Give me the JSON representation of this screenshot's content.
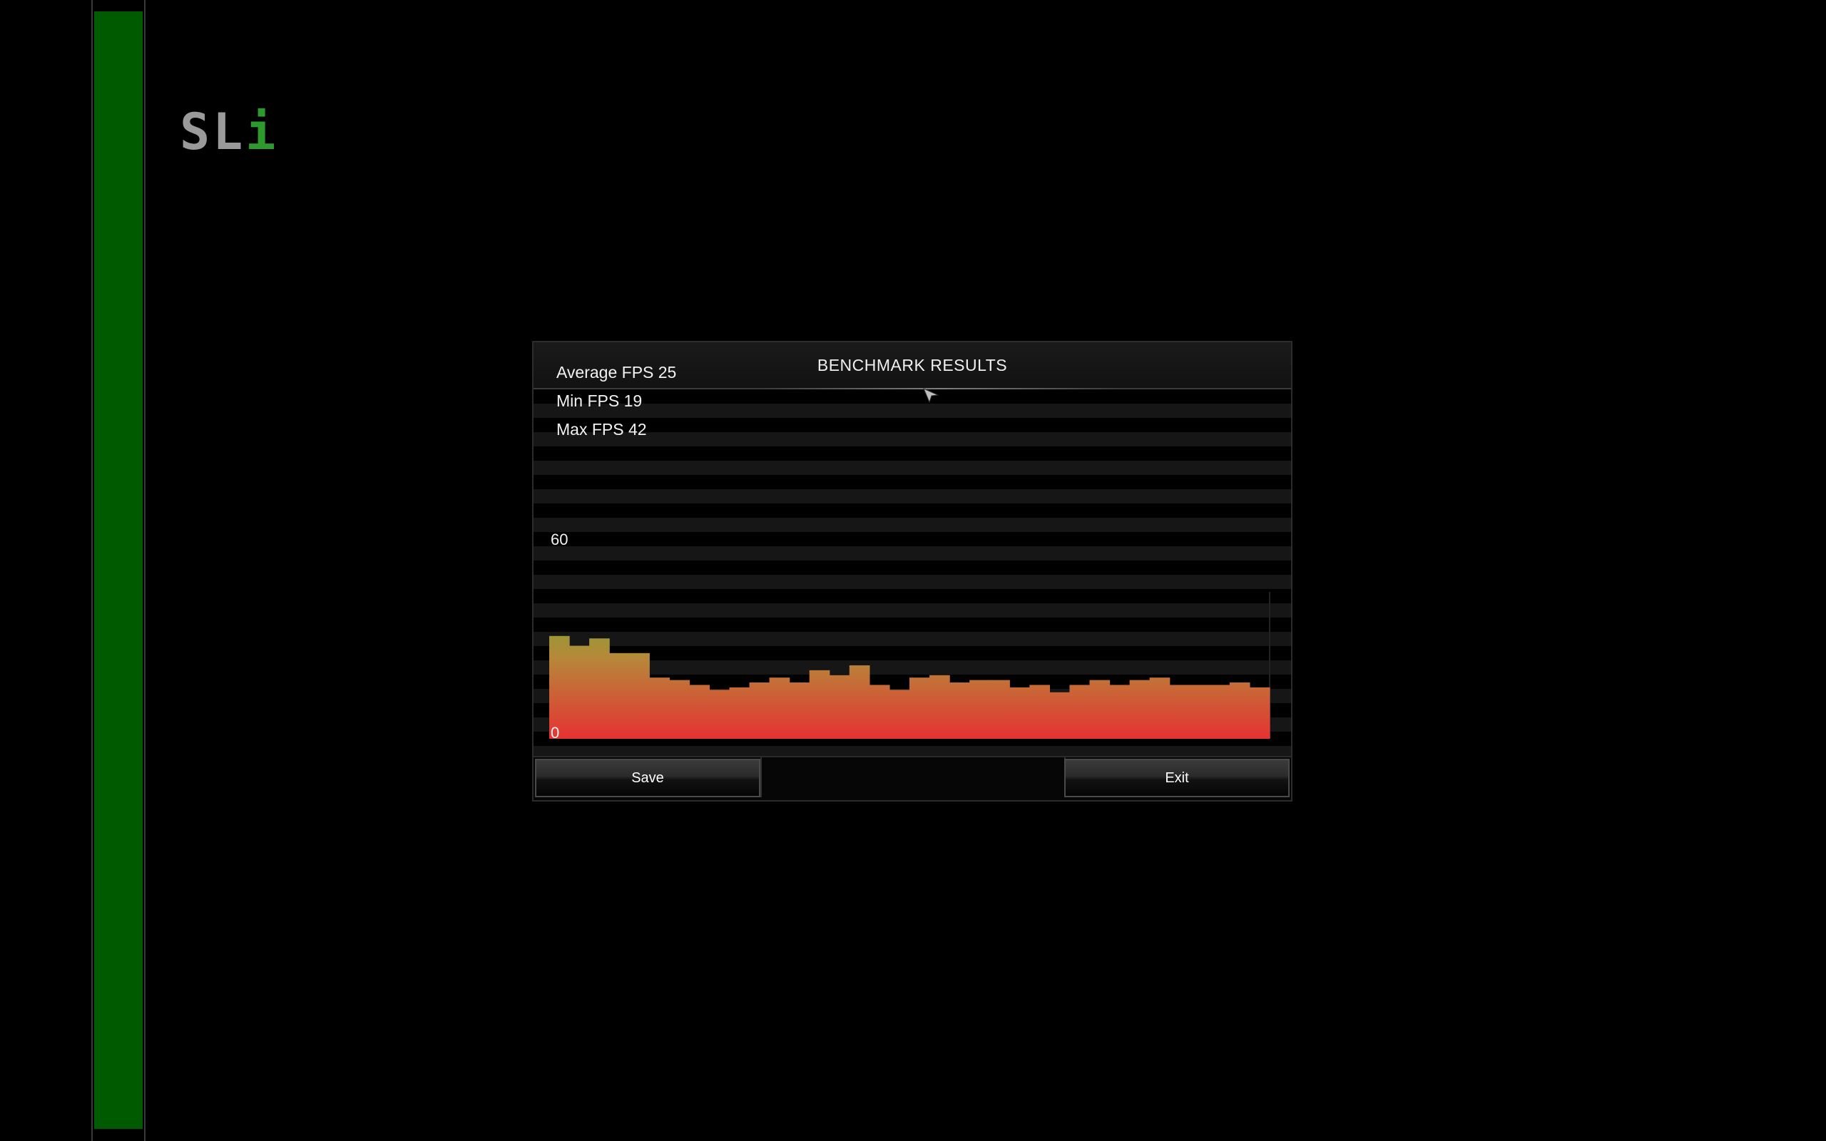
{
  "logo": {
    "text_main": "SL",
    "text_accent": "i"
  },
  "dialog": {
    "title": "BENCHMARK RESULTS",
    "stats": {
      "average": "Average FPS 25",
      "min": "Min FPS 19",
      "max": "Max FPS 42"
    },
    "buttons": {
      "save_label": "Save",
      "exit_label": "Exit"
    }
  },
  "chart_data": {
    "type": "bar",
    "title": "",
    "xlabel": "",
    "ylabel": "",
    "ylim": [
      0,
      60
    ],
    "y_tick_labels": [
      "60",
      "0"
    ],
    "values": [
      42,
      38,
      41,
      35,
      35,
      25,
      24,
      22,
      20,
      21,
      23,
      25,
      23,
      28,
      26,
      30,
      22,
      20,
      25,
      26,
      23,
      24,
      24,
      21,
      22,
      19,
      22,
      24,
      22,
      24,
      25,
      22,
      22,
      22,
      23,
      21
    ],
    "colors": {
      "top": "#6fae2c",
      "mid": "#b6883a",
      "bottom": "#e63232"
    }
  },
  "colors": {
    "sli_green": "#005b00",
    "background": "#000000"
  }
}
